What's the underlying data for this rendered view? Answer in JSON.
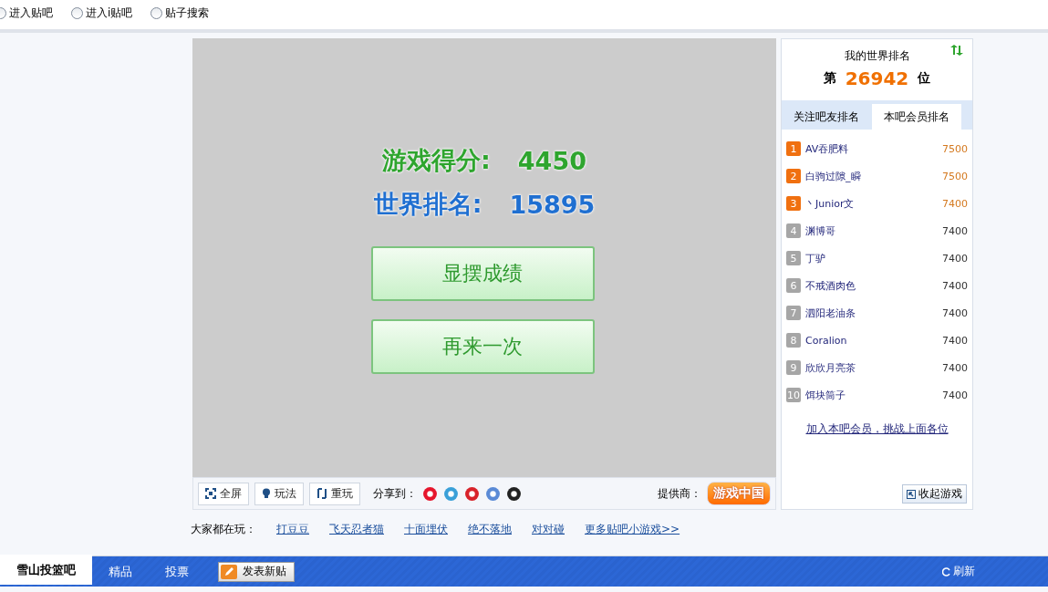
{
  "search_options": [
    {
      "label": "进入贴吧",
      "selected": false
    },
    {
      "label": "进入i贴吧",
      "selected": false
    },
    {
      "label": "贴子搜索",
      "selected": false
    }
  ],
  "game": {
    "score_label": "游戏得分:",
    "score": "4450",
    "rank_label": "世界排名:",
    "rank": "15895",
    "buttons": [
      "显摆成绩",
      "再来一次"
    ]
  },
  "toolbar": {
    "buttons": [
      {
        "label": "全屏",
        "kind": "fullscreen"
      },
      {
        "label": "玩法",
        "kind": "help"
      },
      {
        "label": "重玩",
        "kind": "replay"
      }
    ],
    "share_label": "分享到：",
    "provider_label": "提供商：",
    "provider": "游戏中国"
  },
  "ranking": {
    "title": "我的世界排名",
    "prefix": "第",
    "rank": "26942",
    "suffix": "位",
    "tabs": [
      {
        "label": "关注吧友排名",
        "selected": false
      },
      {
        "label": "本吧会员排名",
        "selected": true
      }
    ],
    "rows": [
      {
        "num": "1",
        "name": "AV吞肥料",
        "score": "7500",
        "top": true
      },
      {
        "num": "2",
        "name": "白驹过隙_瞬",
        "score": "7500",
        "top": true
      },
      {
        "num": "3",
        "name": "丶Junior文",
        "score": "7400",
        "top": true
      },
      {
        "num": "4",
        "name": "渊博哥",
        "score": "7400",
        "top": false
      },
      {
        "num": "5",
        "name": "丁驴",
        "score": "7400",
        "top": false
      },
      {
        "num": "6",
        "name": "不戒酒肉色",
        "score": "7400",
        "top": false
      },
      {
        "num": "7",
        "name": "泗阳老油条",
        "score": "7400",
        "top": false
      },
      {
        "num": "8",
        "name": "Coralion",
        "score": "7400",
        "top": false
      },
      {
        "num": "9",
        "name": "欣欣月亮茶",
        "score": "7400",
        "top": false
      },
      {
        "num": "10",
        "name": "饵块筒子",
        "score": "7400",
        "top": false
      }
    ],
    "join_link": "加入本吧会员，挑战上面各位",
    "collapse": "收起游戏"
  },
  "popular": {
    "label": "大家都在玩：",
    "links": [
      "打豆豆",
      "飞天忍者猫",
      "十面埋伏",
      "绝不落地",
      "对对碰",
      "更多贴吧小游戏>>"
    ]
  },
  "nav": {
    "tabs": [
      {
        "label": "雪山投篮吧",
        "selected": true
      },
      {
        "label": "精品",
        "selected": false
      },
      {
        "label": "投票",
        "selected": false
      }
    ],
    "post_button": "发表新贴",
    "refresh": "刷新"
  }
}
